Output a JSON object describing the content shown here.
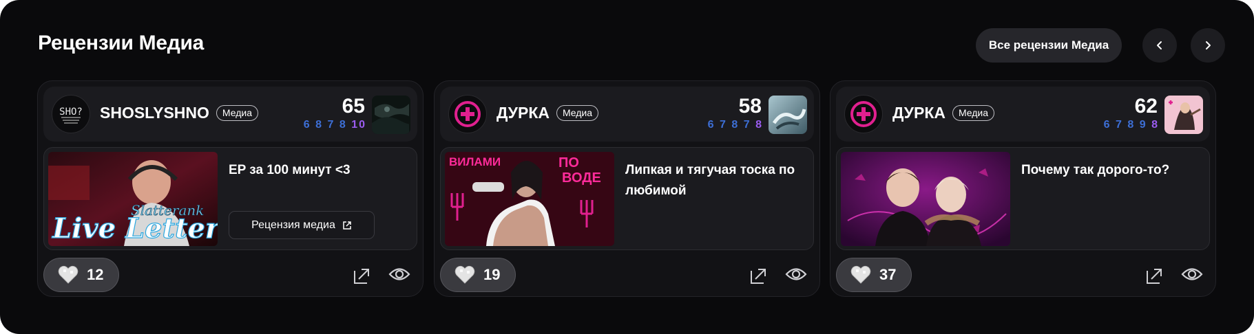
{
  "section": {
    "title": "Рецензии Медиа",
    "all_button": "Все рецензии Медиа"
  },
  "cards": [
    {
      "author": "SHOSLYSHNO",
      "badge": "Медиа",
      "score": "65",
      "sub_scores": [
        "6",
        "8",
        "7",
        "8",
        "10"
      ],
      "sub_colors": [
        "blue",
        "blue",
        "blue",
        "blue",
        "purple"
      ],
      "avatar_text": "SHO?",
      "review_title": "EP за 100 минут <3",
      "cover_text": [
        "Slatterank",
        "Live Letter"
      ],
      "link_label": "Рецензия медиа",
      "likes": "12"
    },
    {
      "author": "ДУРКА",
      "badge": "Медиа",
      "score": "58",
      "sub_scores": [
        "6",
        "7",
        "8",
        "7",
        "8"
      ],
      "sub_colors": [
        "blue",
        "blue",
        "blue",
        "blue",
        "purple"
      ],
      "review_title": "Липкая и тягучая тоска по любимой",
      "cover_text": [
        "ВИЛАМИ",
        "ПО",
        "ВОДЕ"
      ],
      "likes": "19"
    },
    {
      "author": "ДУРКА",
      "badge": "Медиа",
      "score": "62",
      "sub_scores": [
        "6",
        "7",
        "8",
        "9",
        "8"
      ],
      "sub_colors": [
        "blue",
        "blue",
        "blue",
        "blue",
        "purple"
      ],
      "review_title": "Почему так дорого-то?",
      "likes": "37"
    }
  ],
  "icons": {
    "prev": "chevron-left-icon",
    "next": "chevron-right-icon",
    "heart": "heart-icon",
    "share": "share-arrow-icon",
    "eye": "eye-icon",
    "external": "external-link-icon",
    "plus": "plus-circle-icon"
  },
  "colors": {
    "background": "#0a0a0c",
    "card": "#121215",
    "score_blue": "#3d6fd6",
    "score_purple": "#9b5cf0",
    "accent_pink": "#e0208f"
  }
}
